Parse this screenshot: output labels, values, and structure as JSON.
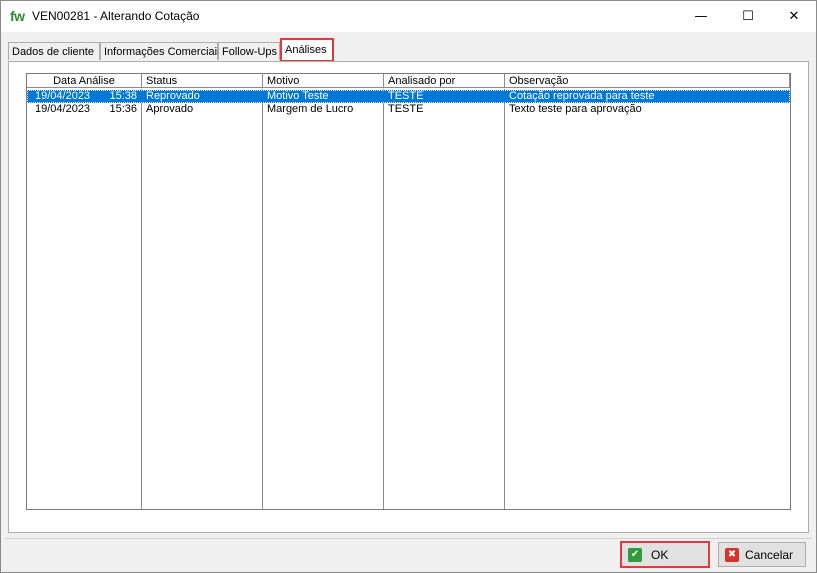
{
  "window": {
    "logo": "fw",
    "title": "VEN00281  - Alterando Cotação",
    "min_icon": "—",
    "max_icon": "☐",
    "close_icon": "✕"
  },
  "tabs": [
    {
      "label": "Dados de cliente"
    },
    {
      "label": "Informações Comerciais"
    },
    {
      "label": "Follow-Ups"
    },
    {
      "label": "Análises",
      "active": true
    }
  ],
  "grid": {
    "columns": [
      "Data Análise",
      "Status",
      "Motivo",
      "Analisado por",
      "Observação"
    ],
    "rows": [
      {
        "data": "19/04/2023",
        "hora": "15:38",
        "status": "Reprovado",
        "motivo": "Motivo Teste",
        "analisado_por": "TESTE",
        "observacao": "Cotação reprovada para teste",
        "selected": true
      },
      {
        "data": "19/04/2023",
        "hora": "15:36",
        "status": "Aprovado",
        "motivo": "Margem de Lucro",
        "analisado_por": "TESTE",
        "observacao": "Texto teste para aprovação",
        "selected": false
      }
    ]
  },
  "buttons": {
    "ok_label": "OK",
    "ok_icon": "✔",
    "cancel_label": "Cancelar",
    "cancel_icon": "✖"
  },
  "colors": {
    "selection": "#0078d7",
    "highlight_border": "#e0393e",
    "logo_green": "#2e8b3a"
  }
}
